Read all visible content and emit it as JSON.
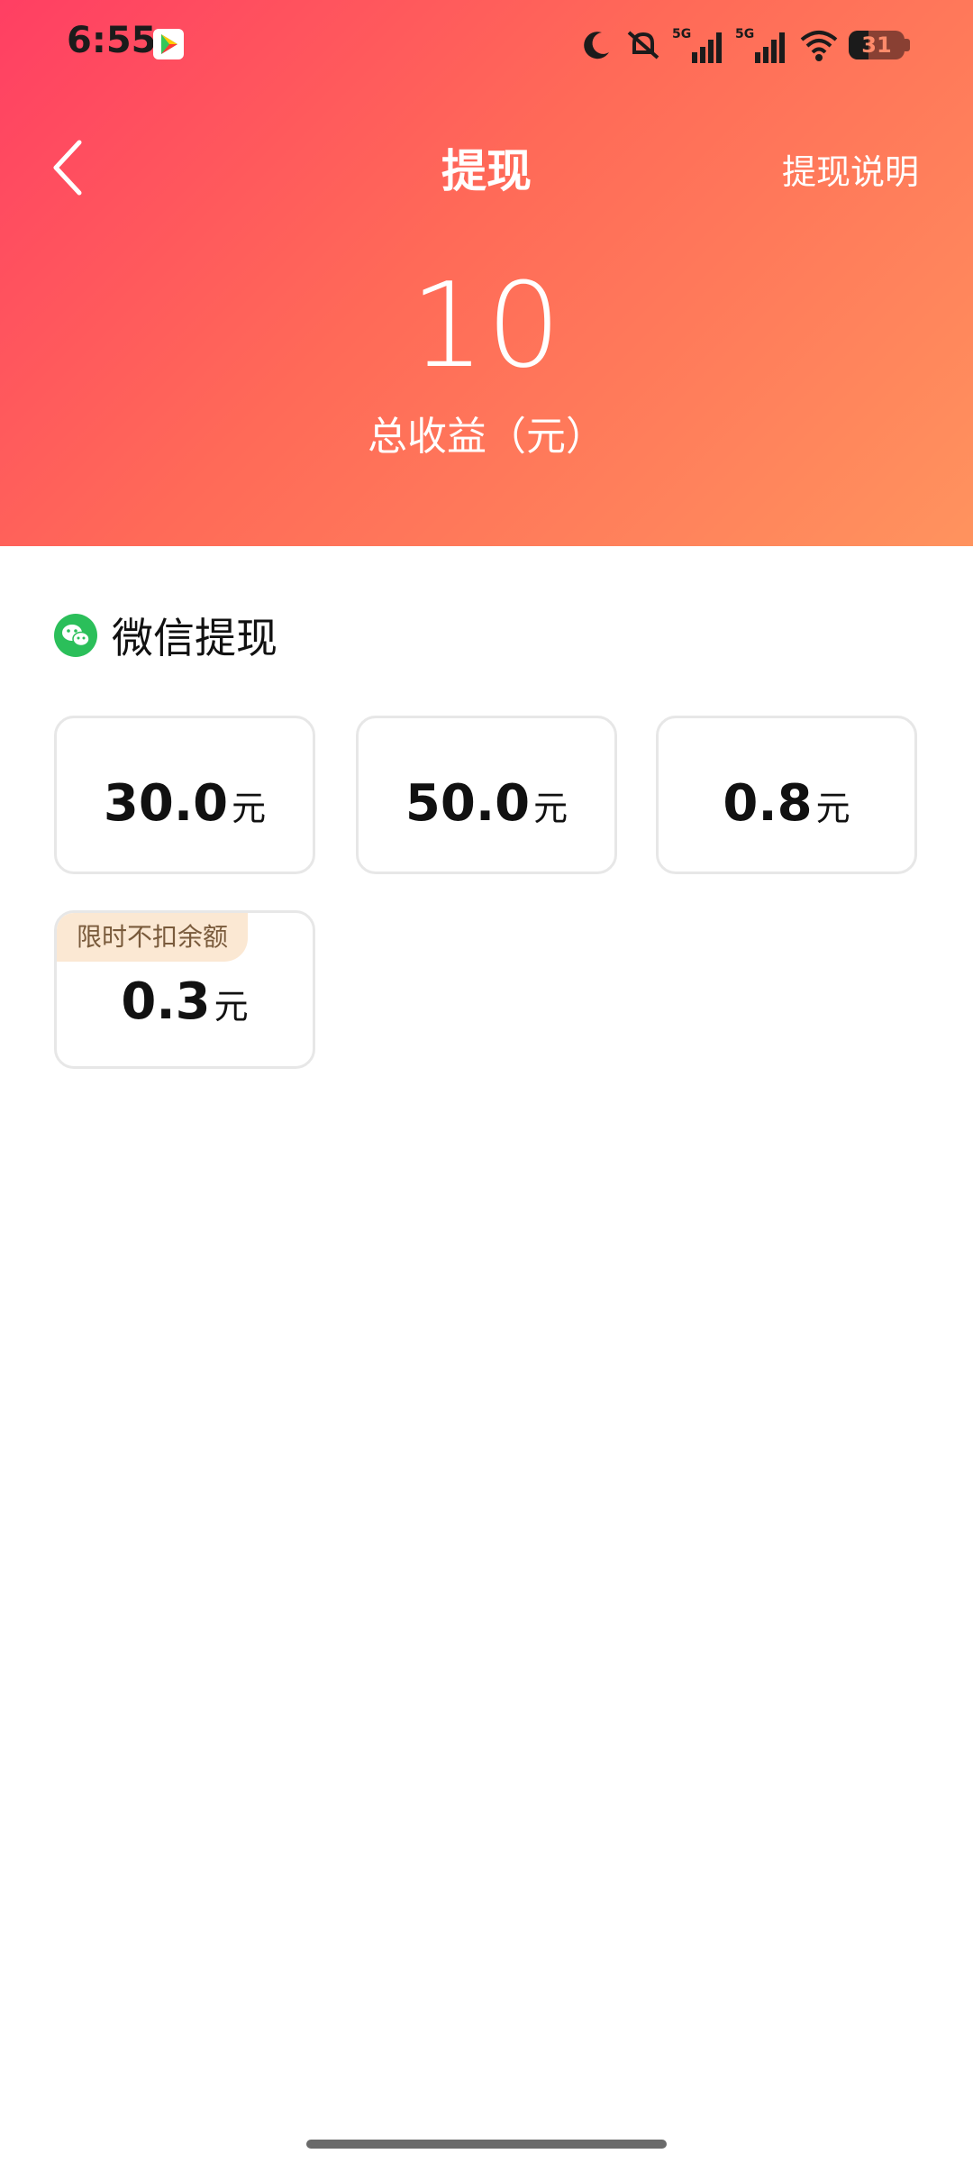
{
  "status_bar": {
    "time": "6:55",
    "battery_level": "31"
  },
  "nav": {
    "title": "提现",
    "help_link": "提现说明"
  },
  "balance": {
    "value": "10",
    "label": "总收益（元）"
  },
  "withdraw_method": {
    "title": "微信提现",
    "icon": "wechat-icon"
  },
  "options": [
    {
      "amount": "30.0",
      "unit": "元"
    },
    {
      "amount": "50.0",
      "unit": "元"
    },
    {
      "amount": "0.8",
      "unit": "元"
    },
    {
      "amount": "0.3",
      "unit": "元",
      "tag": "限时不扣余额"
    }
  ],
  "colors": {
    "header_start": "#ff3f63",
    "header_end": "#ff935e",
    "wechat_green": "#2bbf5a",
    "tag_bg": "#fbe8d3",
    "tag_text": "#7a5b3c"
  }
}
